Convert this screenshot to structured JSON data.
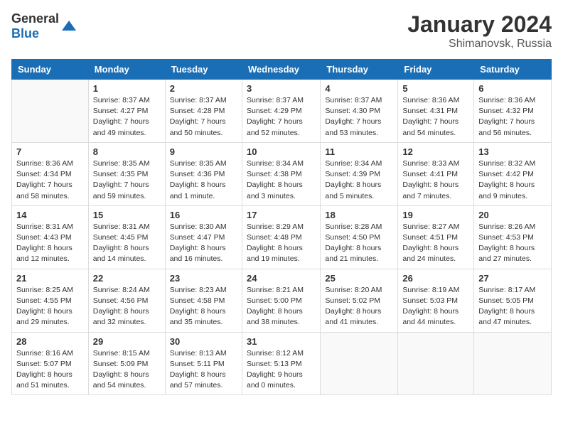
{
  "header": {
    "logo_general": "General",
    "logo_blue": "Blue",
    "month_year": "January 2024",
    "location": "Shimanovsk, Russia"
  },
  "weekdays": [
    "Sunday",
    "Monday",
    "Tuesday",
    "Wednesday",
    "Thursday",
    "Friday",
    "Saturday"
  ],
  "weeks": [
    [
      {
        "day": "",
        "info": ""
      },
      {
        "day": "1",
        "info": "Sunrise: 8:37 AM\nSunset: 4:27 PM\nDaylight: 7 hours\nand 49 minutes."
      },
      {
        "day": "2",
        "info": "Sunrise: 8:37 AM\nSunset: 4:28 PM\nDaylight: 7 hours\nand 50 minutes."
      },
      {
        "day": "3",
        "info": "Sunrise: 8:37 AM\nSunset: 4:29 PM\nDaylight: 7 hours\nand 52 minutes."
      },
      {
        "day": "4",
        "info": "Sunrise: 8:37 AM\nSunset: 4:30 PM\nDaylight: 7 hours\nand 53 minutes."
      },
      {
        "day": "5",
        "info": "Sunrise: 8:36 AM\nSunset: 4:31 PM\nDaylight: 7 hours\nand 54 minutes."
      },
      {
        "day": "6",
        "info": "Sunrise: 8:36 AM\nSunset: 4:32 PM\nDaylight: 7 hours\nand 56 minutes."
      }
    ],
    [
      {
        "day": "7",
        "info": "Sunrise: 8:36 AM\nSunset: 4:34 PM\nDaylight: 7 hours\nand 58 minutes."
      },
      {
        "day": "8",
        "info": "Sunrise: 8:35 AM\nSunset: 4:35 PM\nDaylight: 7 hours\nand 59 minutes."
      },
      {
        "day": "9",
        "info": "Sunrise: 8:35 AM\nSunset: 4:36 PM\nDaylight: 8 hours\nand 1 minute."
      },
      {
        "day": "10",
        "info": "Sunrise: 8:34 AM\nSunset: 4:38 PM\nDaylight: 8 hours\nand 3 minutes."
      },
      {
        "day": "11",
        "info": "Sunrise: 8:34 AM\nSunset: 4:39 PM\nDaylight: 8 hours\nand 5 minutes."
      },
      {
        "day": "12",
        "info": "Sunrise: 8:33 AM\nSunset: 4:41 PM\nDaylight: 8 hours\nand 7 minutes."
      },
      {
        "day": "13",
        "info": "Sunrise: 8:32 AM\nSunset: 4:42 PM\nDaylight: 8 hours\nand 9 minutes."
      }
    ],
    [
      {
        "day": "14",
        "info": "Sunrise: 8:31 AM\nSunset: 4:43 PM\nDaylight: 8 hours\nand 12 minutes."
      },
      {
        "day": "15",
        "info": "Sunrise: 8:31 AM\nSunset: 4:45 PM\nDaylight: 8 hours\nand 14 minutes."
      },
      {
        "day": "16",
        "info": "Sunrise: 8:30 AM\nSunset: 4:47 PM\nDaylight: 8 hours\nand 16 minutes."
      },
      {
        "day": "17",
        "info": "Sunrise: 8:29 AM\nSunset: 4:48 PM\nDaylight: 8 hours\nand 19 minutes."
      },
      {
        "day": "18",
        "info": "Sunrise: 8:28 AM\nSunset: 4:50 PM\nDaylight: 8 hours\nand 21 minutes."
      },
      {
        "day": "19",
        "info": "Sunrise: 8:27 AM\nSunset: 4:51 PM\nDaylight: 8 hours\nand 24 minutes."
      },
      {
        "day": "20",
        "info": "Sunrise: 8:26 AM\nSunset: 4:53 PM\nDaylight: 8 hours\nand 27 minutes."
      }
    ],
    [
      {
        "day": "21",
        "info": "Sunrise: 8:25 AM\nSunset: 4:55 PM\nDaylight: 8 hours\nand 29 minutes."
      },
      {
        "day": "22",
        "info": "Sunrise: 8:24 AM\nSunset: 4:56 PM\nDaylight: 8 hours\nand 32 minutes."
      },
      {
        "day": "23",
        "info": "Sunrise: 8:23 AM\nSunset: 4:58 PM\nDaylight: 8 hours\nand 35 minutes."
      },
      {
        "day": "24",
        "info": "Sunrise: 8:21 AM\nSunset: 5:00 PM\nDaylight: 8 hours\nand 38 minutes."
      },
      {
        "day": "25",
        "info": "Sunrise: 8:20 AM\nSunset: 5:02 PM\nDaylight: 8 hours\nand 41 minutes."
      },
      {
        "day": "26",
        "info": "Sunrise: 8:19 AM\nSunset: 5:03 PM\nDaylight: 8 hours\nand 44 minutes."
      },
      {
        "day": "27",
        "info": "Sunrise: 8:17 AM\nSunset: 5:05 PM\nDaylight: 8 hours\nand 47 minutes."
      }
    ],
    [
      {
        "day": "28",
        "info": "Sunrise: 8:16 AM\nSunset: 5:07 PM\nDaylight: 8 hours\nand 51 minutes."
      },
      {
        "day": "29",
        "info": "Sunrise: 8:15 AM\nSunset: 5:09 PM\nDaylight: 8 hours\nand 54 minutes."
      },
      {
        "day": "30",
        "info": "Sunrise: 8:13 AM\nSunset: 5:11 PM\nDaylight: 8 hours\nand 57 minutes."
      },
      {
        "day": "31",
        "info": "Sunrise: 8:12 AM\nSunset: 5:13 PM\nDaylight: 9 hours\nand 0 minutes."
      },
      {
        "day": "",
        "info": ""
      },
      {
        "day": "",
        "info": ""
      },
      {
        "day": "",
        "info": ""
      }
    ]
  ]
}
